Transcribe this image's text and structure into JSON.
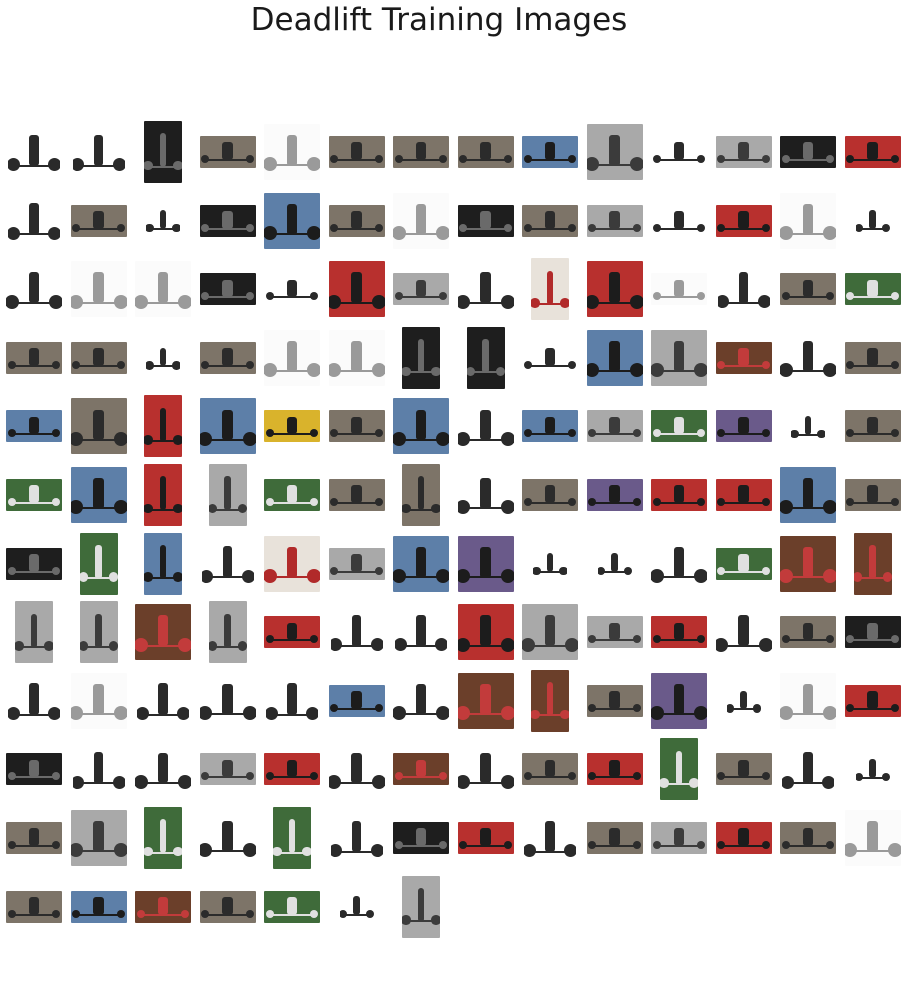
{
  "title": "Deadlift Training Images",
  "thumbnails": [
    {
      "tone": "white",
      "shape": "tall"
    },
    {
      "tone": "white",
      "shape": "tall"
    },
    {
      "tone": "dark",
      "shape": "portrait"
    },
    {
      "tone": "gym",
      "shape": "wide"
    },
    {
      "tone": "sketch",
      "shape": "square"
    },
    {
      "tone": "gym",
      "shape": "wide"
    },
    {
      "tone": "gym",
      "shape": "wide"
    },
    {
      "tone": "gym",
      "shape": "wide"
    },
    {
      "tone": "blue",
      "shape": "wide"
    },
    {
      "tone": "gray",
      "shape": "square"
    },
    {
      "tone": "white",
      "shape": "wide"
    },
    {
      "tone": "gray",
      "shape": "wide"
    },
    {
      "tone": "dark",
      "shape": "wide"
    },
    {
      "tone": "red",
      "shape": "wide"
    },
    {
      "tone": "white",
      "shape": "tall"
    },
    {
      "tone": "gym",
      "shape": "wide"
    },
    {
      "tone": "white",
      "shape": "small"
    },
    {
      "tone": "dark",
      "shape": "wide"
    },
    {
      "tone": "blue",
      "shape": "square"
    },
    {
      "tone": "gym",
      "shape": "wide"
    },
    {
      "tone": "sketch",
      "shape": "square"
    },
    {
      "tone": "dark",
      "shape": "wide"
    },
    {
      "tone": "gym",
      "shape": "wide"
    },
    {
      "tone": "gray",
      "shape": "wide"
    },
    {
      "tone": "white",
      "shape": "wide"
    },
    {
      "tone": "red",
      "shape": "wide"
    },
    {
      "tone": "sketch",
      "shape": "square"
    },
    {
      "tone": "white",
      "shape": "small"
    },
    {
      "tone": "white",
      "shape": "square"
    },
    {
      "tone": "sketch",
      "shape": "square"
    },
    {
      "tone": "sketch",
      "shape": "square"
    },
    {
      "tone": "dark",
      "shape": "wide"
    },
    {
      "tone": "white",
      "shape": "wide"
    },
    {
      "tone": "red",
      "shape": "square"
    },
    {
      "tone": "gray",
      "shape": "wide"
    },
    {
      "tone": "white",
      "shape": "square"
    },
    {
      "tone": "poster",
      "shape": "portrait"
    },
    {
      "tone": "red",
      "shape": "square"
    },
    {
      "tone": "sketch",
      "shape": "wide"
    },
    {
      "tone": "white",
      "shape": "tall"
    },
    {
      "tone": "gym",
      "shape": "wide"
    },
    {
      "tone": "green",
      "shape": "wide"
    },
    {
      "tone": "gym",
      "shape": "wide"
    },
    {
      "tone": "gym",
      "shape": "wide"
    },
    {
      "tone": "white",
      "shape": "small"
    },
    {
      "tone": "gym",
      "shape": "wide"
    },
    {
      "tone": "sketch",
      "shape": "square"
    },
    {
      "tone": "sketch",
      "shape": "square"
    },
    {
      "tone": "dark",
      "shape": "portrait"
    },
    {
      "tone": "dark",
      "shape": "portrait"
    },
    {
      "tone": "white",
      "shape": "wide"
    },
    {
      "tone": "blue",
      "shape": "square"
    },
    {
      "tone": "gray",
      "shape": "square"
    },
    {
      "tone": "brown",
      "shape": "wide"
    },
    {
      "tone": "white",
      "shape": "square"
    },
    {
      "tone": "gym",
      "shape": "wide"
    },
    {
      "tone": "blue",
      "shape": "wide"
    },
    {
      "tone": "gym",
      "shape": "square"
    },
    {
      "tone": "red",
      "shape": "portrait"
    },
    {
      "tone": "blue",
      "shape": "square"
    },
    {
      "tone": "yellow",
      "shape": "wide"
    },
    {
      "tone": "gym",
      "shape": "wide"
    },
    {
      "tone": "blue",
      "shape": "square"
    },
    {
      "tone": "white",
      "shape": "square"
    },
    {
      "tone": "blue",
      "shape": "wide"
    },
    {
      "tone": "gray",
      "shape": "wide"
    },
    {
      "tone": "green",
      "shape": "wide"
    },
    {
      "tone": "purple",
      "shape": "wide"
    },
    {
      "tone": "white",
      "shape": "small"
    },
    {
      "tone": "gym",
      "shape": "wide"
    },
    {
      "tone": "green",
      "shape": "wide"
    },
    {
      "tone": "blue",
      "shape": "square"
    },
    {
      "tone": "red",
      "shape": "portrait"
    },
    {
      "tone": "gray",
      "shape": "portrait"
    },
    {
      "tone": "green",
      "shape": "wide"
    },
    {
      "tone": "gym",
      "shape": "wide"
    },
    {
      "tone": "gym",
      "shape": "portrait"
    },
    {
      "tone": "white",
      "shape": "square"
    },
    {
      "tone": "gym",
      "shape": "wide"
    },
    {
      "tone": "purple",
      "shape": "wide"
    },
    {
      "tone": "red",
      "shape": "wide"
    },
    {
      "tone": "red",
      "shape": "wide"
    },
    {
      "tone": "blue",
      "shape": "square"
    },
    {
      "tone": "gym",
      "shape": "wide"
    },
    {
      "tone": "dark",
      "shape": "wide"
    },
    {
      "tone": "green",
      "shape": "portrait"
    },
    {
      "tone": "blue",
      "shape": "portrait"
    },
    {
      "tone": "white",
      "shape": "tall"
    },
    {
      "tone": "poster",
      "shape": "square"
    },
    {
      "tone": "gray",
      "shape": "wide"
    },
    {
      "tone": "blue",
      "shape": "square"
    },
    {
      "tone": "purple",
      "shape": "square"
    },
    {
      "tone": "white",
      "shape": "small"
    },
    {
      "tone": "white",
      "shape": "small"
    },
    {
      "tone": "white",
      "shape": "square"
    },
    {
      "tone": "green",
      "shape": "wide"
    },
    {
      "tone": "brown",
      "shape": "square"
    },
    {
      "tone": "brown",
      "shape": "portrait"
    },
    {
      "tone": "gray",
      "shape": "portrait"
    },
    {
      "tone": "gray",
      "shape": "portrait"
    },
    {
      "tone": "brown",
      "shape": "square"
    },
    {
      "tone": "gray",
      "shape": "portrait"
    },
    {
      "tone": "red",
      "shape": "wide"
    },
    {
      "tone": "white",
      "shape": "tall"
    },
    {
      "tone": "white",
      "shape": "tall"
    },
    {
      "tone": "red",
      "shape": "square"
    },
    {
      "tone": "gray",
      "shape": "square"
    },
    {
      "tone": "gray",
      "shape": "wide"
    },
    {
      "tone": "red",
      "shape": "wide"
    },
    {
      "tone": "white",
      "shape": "square"
    },
    {
      "tone": "gym",
      "shape": "wide"
    },
    {
      "tone": "dark",
      "shape": "wide"
    },
    {
      "tone": "white",
      "shape": "tall"
    },
    {
      "tone": "sketch",
      "shape": "square"
    },
    {
      "tone": "white",
      "shape": "tall"
    },
    {
      "tone": "white",
      "shape": "square"
    },
    {
      "tone": "white",
      "shape": "tall"
    },
    {
      "tone": "blue",
      "shape": "wide"
    },
    {
      "tone": "white",
      "shape": "square"
    },
    {
      "tone": "brown",
      "shape": "square"
    },
    {
      "tone": "brown",
      "shape": "portrait"
    },
    {
      "tone": "gym",
      "shape": "wide"
    },
    {
      "tone": "purple",
      "shape": "square"
    },
    {
      "tone": "white",
      "shape": "small"
    },
    {
      "tone": "sketch",
      "shape": "square"
    },
    {
      "tone": "red",
      "shape": "wide"
    },
    {
      "tone": "dark",
      "shape": "wide"
    },
    {
      "tone": "white",
      "shape": "tall"
    },
    {
      "tone": "white",
      "shape": "square"
    },
    {
      "tone": "gray",
      "shape": "wide"
    },
    {
      "tone": "red",
      "shape": "wide"
    },
    {
      "tone": "white",
      "shape": "square"
    },
    {
      "tone": "brown",
      "shape": "wide"
    },
    {
      "tone": "white",
      "shape": "square"
    },
    {
      "tone": "gym",
      "shape": "wide"
    },
    {
      "tone": "red",
      "shape": "wide"
    },
    {
      "tone": "green",
      "shape": "portrait"
    },
    {
      "tone": "gym",
      "shape": "wide"
    },
    {
      "tone": "white",
      "shape": "tall"
    },
    {
      "tone": "white",
      "shape": "small"
    },
    {
      "tone": "gym",
      "shape": "wide"
    },
    {
      "tone": "gray",
      "shape": "square"
    },
    {
      "tone": "green",
      "shape": "portrait"
    },
    {
      "tone": "white",
      "shape": "square"
    },
    {
      "tone": "green",
      "shape": "portrait"
    },
    {
      "tone": "white",
      "shape": "tall"
    },
    {
      "tone": "dark",
      "shape": "wide"
    },
    {
      "tone": "red",
      "shape": "wide"
    },
    {
      "tone": "white",
      "shape": "tall"
    },
    {
      "tone": "gym",
      "shape": "wide"
    },
    {
      "tone": "gray",
      "shape": "wide"
    },
    {
      "tone": "red",
      "shape": "wide"
    },
    {
      "tone": "gym",
      "shape": "wide"
    },
    {
      "tone": "sketch",
      "shape": "square"
    },
    {
      "tone": "gym",
      "shape": "wide"
    },
    {
      "tone": "blue",
      "shape": "wide"
    },
    {
      "tone": "brown",
      "shape": "wide"
    },
    {
      "tone": "gym",
      "shape": "wide"
    },
    {
      "tone": "green",
      "shape": "wide"
    },
    {
      "tone": "white",
      "shape": "small"
    },
    {
      "tone": "gray",
      "shape": "portrait"
    }
  ],
  "tones": {
    "white": {
      "bg": "#ffffff",
      "fig": "#2a2a2a"
    },
    "dark": {
      "bg": "#1e1e1e",
      "fig": "#6a6a6a"
    },
    "gym": {
      "bg": "#7d7468",
      "fig": "#2b2b2b"
    },
    "gray": {
      "bg": "#a9a9a9",
      "fig": "#3b3b3b"
    },
    "blue": {
      "bg": "#5d7fa8",
      "fig": "#1c1c1c"
    },
    "red": {
      "bg": "#b8302e",
      "fig": "#1c1c1c"
    },
    "green": {
      "bg": "#3f6b3a",
      "fig": "#e0e0e0"
    },
    "brown": {
      "bg": "#6b3f2a",
      "fig": "#c23b3b"
    },
    "purple": {
      "bg": "#6a5a8a",
      "fig": "#1c1c1c"
    },
    "yellow": {
      "bg": "#d9b32c",
      "fig": "#1c1c1c"
    },
    "sketch": {
      "bg": "#fbfbfb",
      "fig": "#9a9a9a"
    },
    "poster": {
      "bg": "#e8e2da",
      "fig": "#b12a2a"
    }
  }
}
